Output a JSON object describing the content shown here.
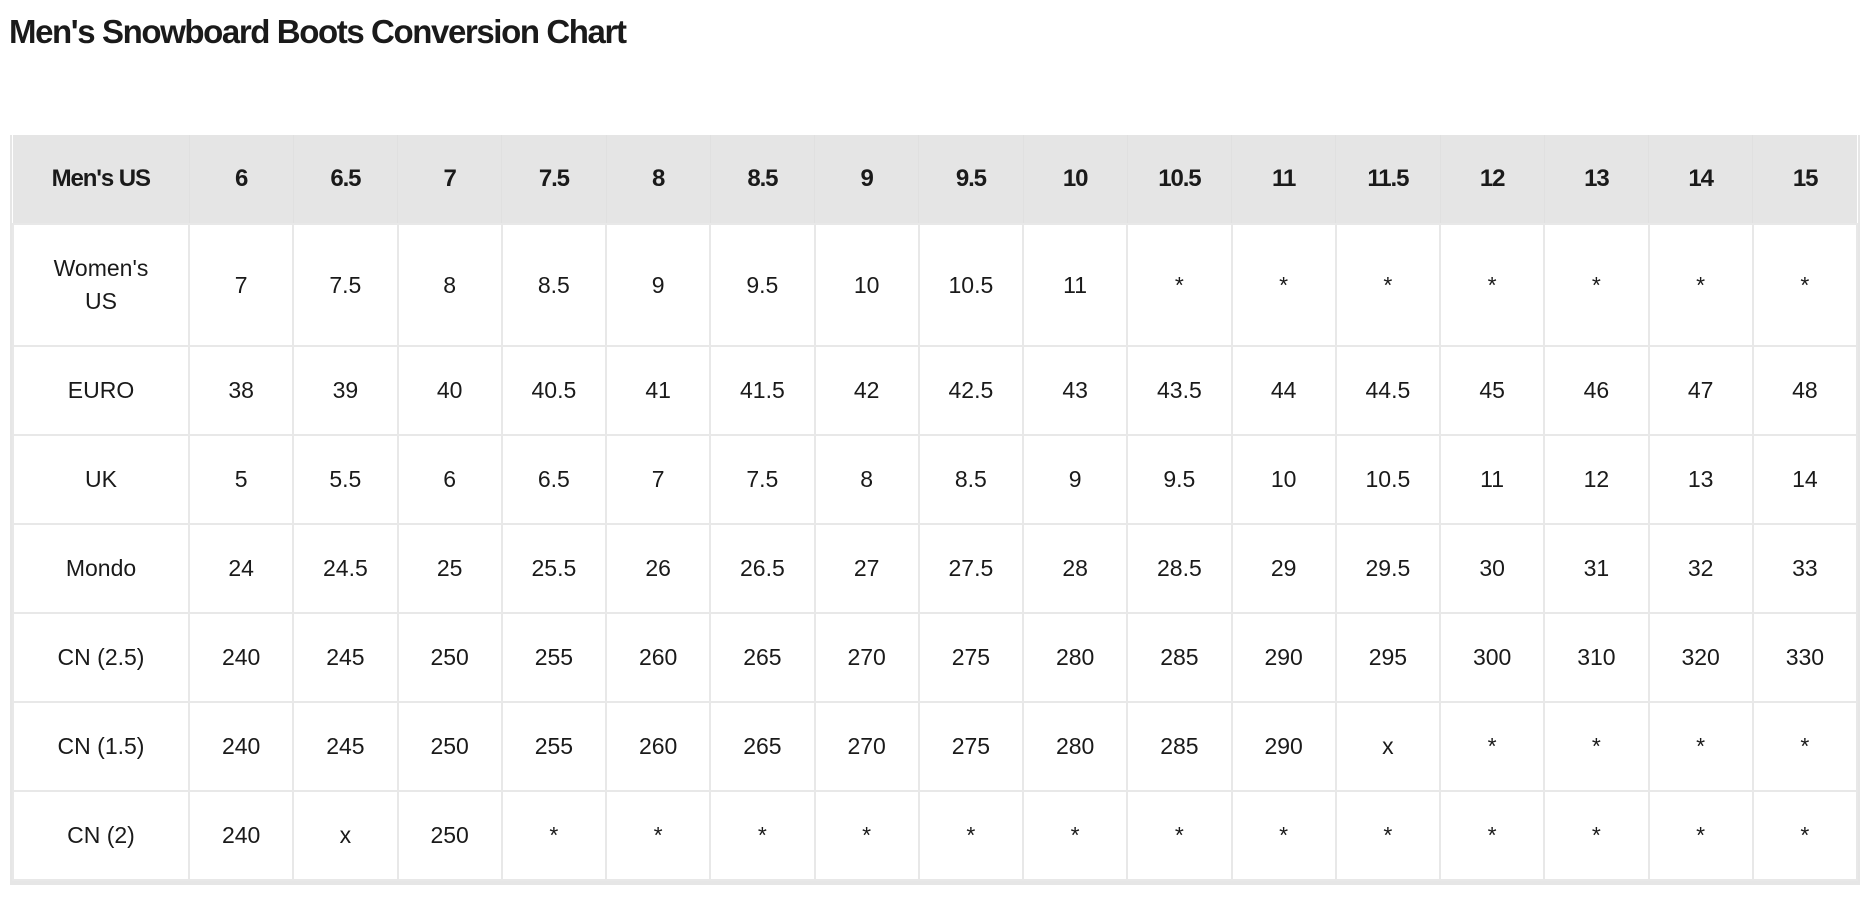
{
  "page": {
    "title": "Men's Snowboard Boots Conversion Chart"
  },
  "table": {
    "header": {
      "label": "Men's US",
      "sizes": [
        "6",
        "6.5",
        "7",
        "7.5",
        "8",
        "8.5",
        "9",
        "9.5",
        "10",
        "10.5",
        "11",
        "11.5",
        "12",
        "13",
        "14",
        "15"
      ]
    },
    "rows": [
      {
        "label": "Women's US",
        "values": [
          "7",
          "7.5",
          "8",
          "8.5",
          "9",
          "9.5",
          "10",
          "10.5",
          "11",
          "*",
          "*",
          "*",
          "*",
          "*",
          "*",
          "*"
        ]
      },
      {
        "label": "EURO",
        "values": [
          "38",
          "39",
          "40",
          "40.5",
          "41",
          "41.5",
          "42",
          "42.5",
          "43",
          "43.5",
          "44",
          "44.5",
          "45",
          "46",
          "47",
          "48"
        ]
      },
      {
        "label": "UK",
        "values": [
          "5",
          "5.5",
          "6",
          "6.5",
          "7",
          "7.5",
          "8",
          "8.5",
          "9",
          "9.5",
          "10",
          "10.5",
          "11",
          "12",
          "13",
          "14"
        ]
      },
      {
        "label": "Mondo",
        "values": [
          "24",
          "24.5",
          "25",
          "25.5",
          "26",
          "26.5",
          "27",
          "27.5",
          "28",
          "28.5",
          "29",
          "29.5",
          "30",
          "31",
          "32",
          "33"
        ]
      },
      {
        "label": "CN (2.5)",
        "values": [
          "240",
          "245",
          "250",
          "255",
          "260",
          "265",
          "270",
          "275",
          "280",
          "285",
          "290",
          "295",
          "300",
          "310",
          "320",
          "330"
        ]
      },
      {
        "label": "CN (1.5)",
        "values": [
          "240",
          "245",
          "250",
          "255",
          "260",
          "265",
          "270",
          "275",
          "280",
          "285",
          "290",
          "x",
          "*",
          "*",
          "*",
          "*"
        ]
      },
      {
        "label": "CN (2)",
        "values": [
          "240",
          "x",
          "250",
          "*",
          "*",
          "*",
          "*",
          "*",
          "*",
          "*",
          "*",
          "*",
          "*",
          "*",
          "*",
          "*"
        ]
      }
    ]
  },
  "colors": {
    "header_bg": "#e5e5e5",
    "grid_line": "#e8e8e8",
    "text": "#1a1a1a"
  }
}
